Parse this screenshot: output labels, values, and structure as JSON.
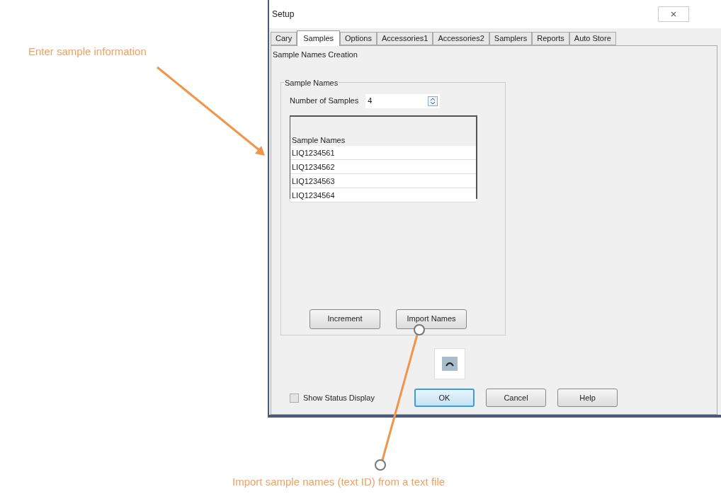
{
  "annotations": [
    {
      "text": "Enter sample information"
    },
    {
      "text": "Import sample names (text ID) from a text file"
    }
  ],
  "window": {
    "title": "Setup"
  },
  "tabs": [
    {
      "label": "Cary",
      "selected": false
    },
    {
      "label": "Samples",
      "selected": true
    },
    {
      "label": "Options",
      "selected": false
    },
    {
      "label": "Accessories1",
      "selected": false
    },
    {
      "label": "Accessories2",
      "selected": false
    },
    {
      "label": "Samplers",
      "selected": false
    },
    {
      "label": "Reports",
      "selected": false
    },
    {
      "label": "Auto Store",
      "selected": false
    }
  ],
  "panel_title": "Sample Names Creation",
  "group": {
    "title": "Sample Names",
    "number_label": "Number of Samples",
    "number_value": "4",
    "list_header": "Sample Names",
    "rows": [
      "LIQ1234561",
      "LIQ1234562",
      "LIQ1234563",
      "LIQ1234564"
    ],
    "buttons": [
      "Increment",
      "Import Names"
    ]
  },
  "show_status": {
    "label": "Show Status Display",
    "checked": false
  },
  "buttons": [
    {
      "label": "OK",
      "default": true
    },
    {
      "label": "Cancel",
      "default": false
    },
    {
      "label": "Help",
      "default": false
    }
  ]
}
